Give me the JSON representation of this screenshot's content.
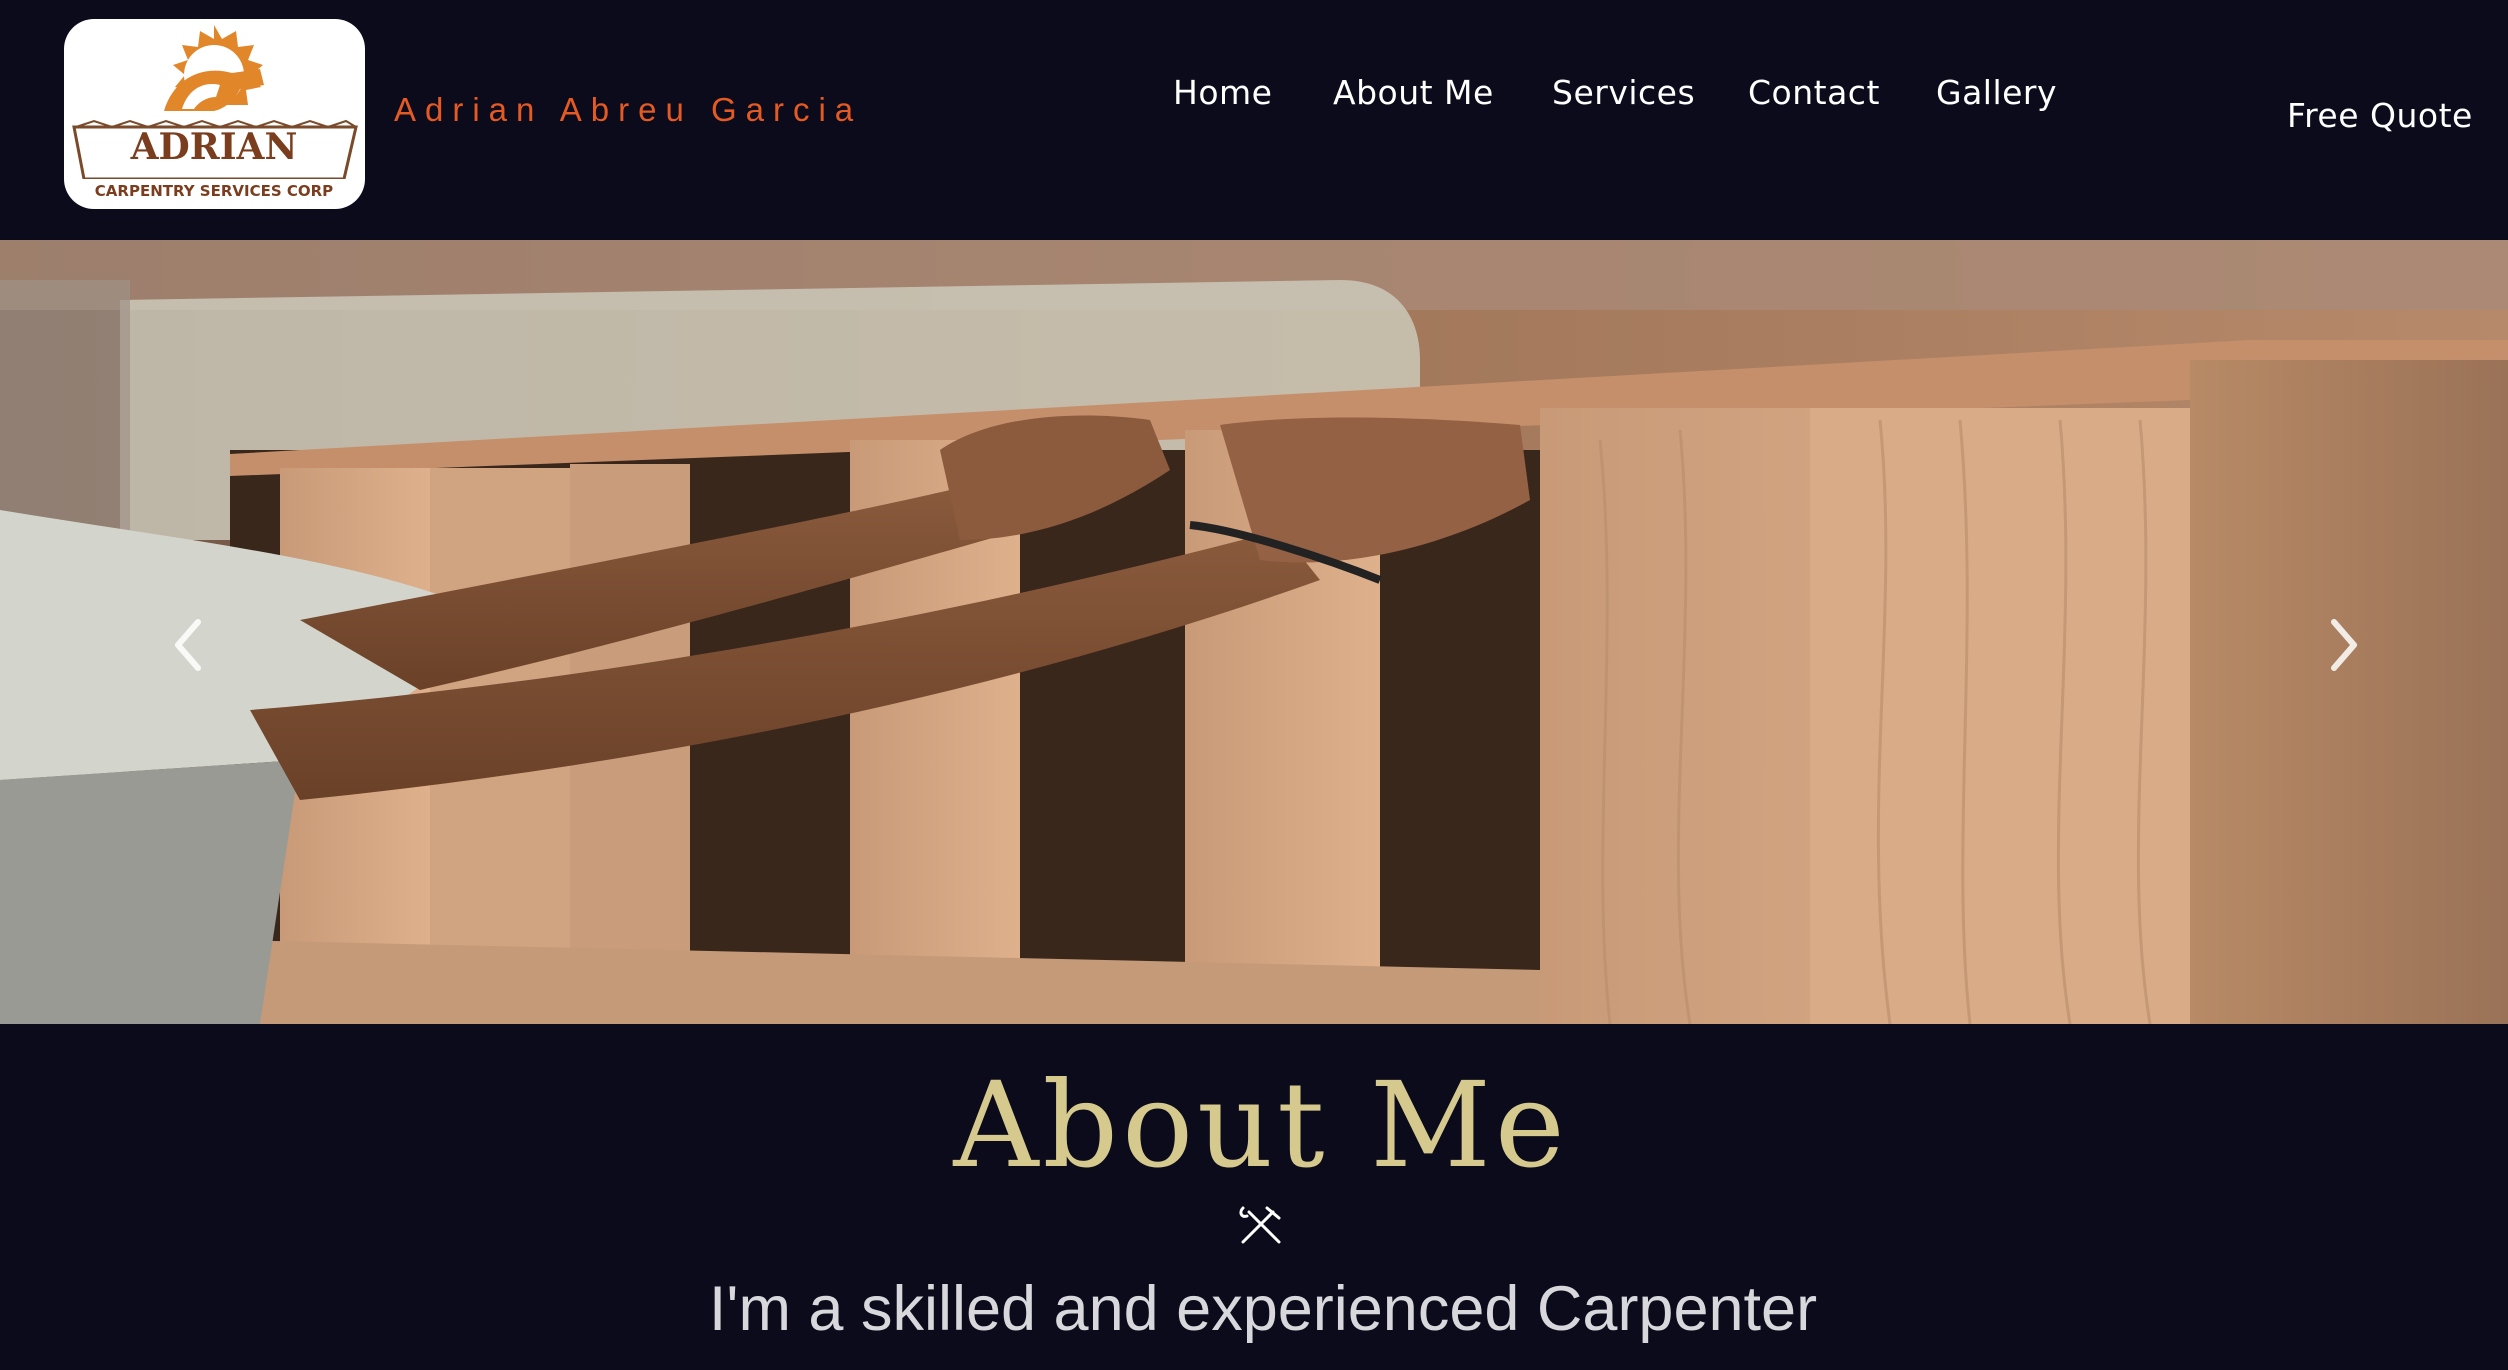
{
  "header": {
    "logo": {
      "name": "ADRIAN",
      "tagline": "CARPENTRY SERVICES CORP"
    },
    "brand_name": "Adrian Abreu Garcia",
    "nav": [
      {
        "label": "Home"
      },
      {
        "label": "About Me"
      },
      {
        "label": "Services"
      },
      {
        "label": "Contact"
      },
      {
        "label": "Gallery"
      }
    ],
    "cta_label": "Free Quote"
  },
  "hero": {
    "prev_icon": "chevron-left-icon",
    "next_icon": "chevron-right-icon"
  },
  "about": {
    "title": "About Me",
    "icon": "hammer-wrench-icon",
    "subtitle": "I'm a skilled and experienced Carpenter"
  },
  "colors": {
    "background": "#0b0b1c",
    "brand_orange": "#e45a22",
    "title_gold": "#d6c98d",
    "nav_text": "#ffffff",
    "subtitle_text": "#d8d8dc"
  }
}
